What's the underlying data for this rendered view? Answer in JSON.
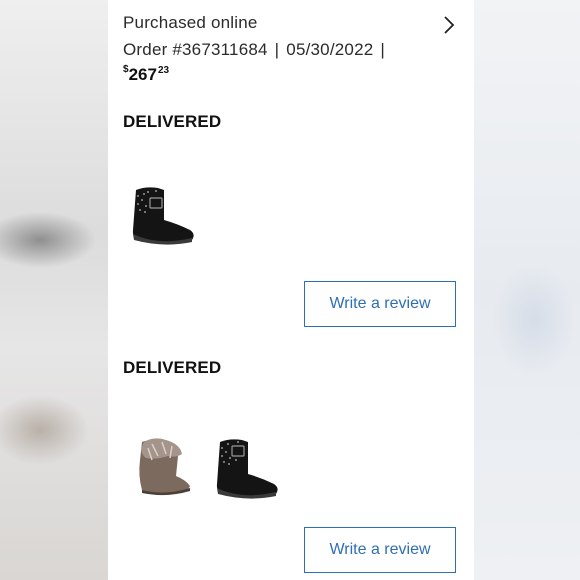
{
  "order": {
    "purchase_channel": "Purchased online",
    "order_number": "Order #367311684",
    "date": "05/30/2022",
    "separator": "|",
    "price_currency": "$",
    "price_dollars": "267",
    "price_cents": "23"
  },
  "shipments": [
    {
      "status": "DELIVERED",
      "items": [
        {
          "product_icon": "black-studded-ugg-boot-image"
        }
      ],
      "review_button": "Write a review"
    },
    {
      "status": "DELIVERED",
      "items": [
        {
          "product_icon": "fur-pom-boot-image"
        },
        {
          "product_icon": "black-studded-ugg-boot-image"
        }
      ],
      "review_button": "Write a review"
    }
  ],
  "colors": {
    "accent": "#2f6fb3",
    "text": "#2b2b2b"
  }
}
